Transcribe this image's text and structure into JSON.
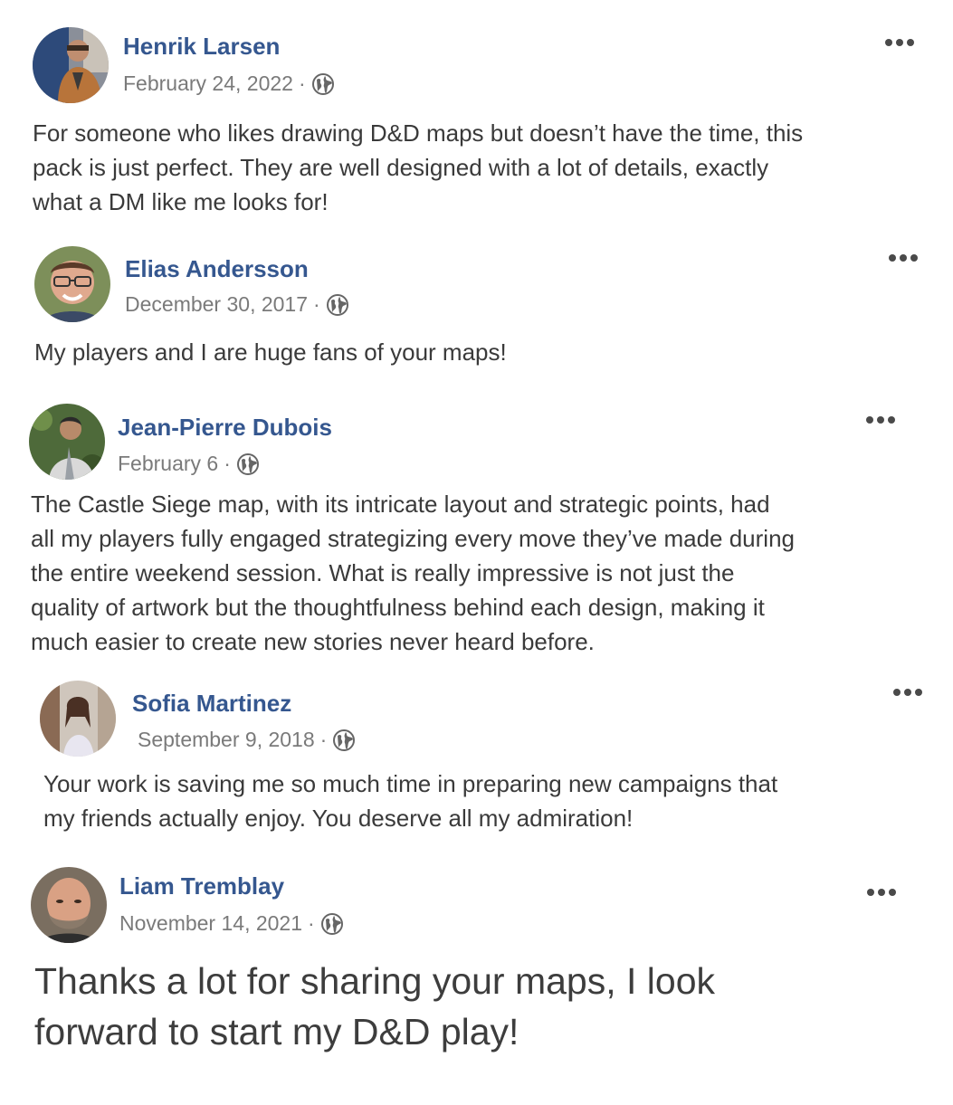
{
  "posts": [
    {
      "author": "Henrik Larsen",
      "date": "February 24, 2022",
      "separator": "·",
      "avatar_icon": "avatar-photo-man-tan-jacket",
      "privacy_icon": "globe-icon",
      "more_icon": "more-options-icon",
      "text_lines": [
        "For someone who likes drawing D&D maps but doesn’t have the time, this",
        "pack is just perfect. They are well designed with a lot of details, exactly",
        "what a DM like me looks for!"
      ]
    },
    {
      "author": "Elias Andersson",
      "date": "December 30, 2017",
      "separator": "·",
      "avatar_icon": "avatar-photo-man-glasses",
      "privacy_icon": "globe-icon",
      "more_icon": "more-options-icon",
      "text_lines": [
        "My players and I are huge fans of your maps!"
      ]
    },
    {
      "author": "Jean-Pierre Dubois",
      "date": "February 6",
      "separator": "·",
      "avatar_icon": "avatar-photo-man-outdoors",
      "privacy_icon": "globe-icon",
      "more_icon": "more-options-icon",
      "text_lines": [
        "The Castle Siege map, with its intricate layout and strategic points, had",
        "all my players fully engaged strategizing every move they’ve made during",
        "the entire weekend session. What is really impressive is not just the",
        "quality of artwork but the thoughtfulness behind each design, making it",
        "much easier to create new stories never heard before."
      ]
    },
    {
      "author": "Sofia Martinez",
      "date": "September 9, 2018",
      "separator": "·",
      "avatar_icon": "avatar-photo-woman-street",
      "privacy_icon": "globe-icon",
      "more_icon": "more-options-icon",
      "text_lines": [
        "Your work is saving me so much time in preparing new campaigns that",
        "my friends actually enjoy. You deserve all my admiration!"
      ]
    },
    {
      "author": "Liam Tremblay",
      "date": "November 14, 2021",
      "separator": "·",
      "avatar_icon": "avatar-photo-bald-man-beard",
      "privacy_icon": "globe-icon",
      "more_icon": "more-options-icon",
      "text_lines": [
        "Thanks a lot for sharing your maps, I look",
        "forward to start my D&D play!"
      ]
    }
  ],
  "colors": {
    "author_name": "#35578f",
    "meta_text": "#7a7a7a",
    "body_text": "#3a3a3a",
    "background": "#ffffff"
  }
}
